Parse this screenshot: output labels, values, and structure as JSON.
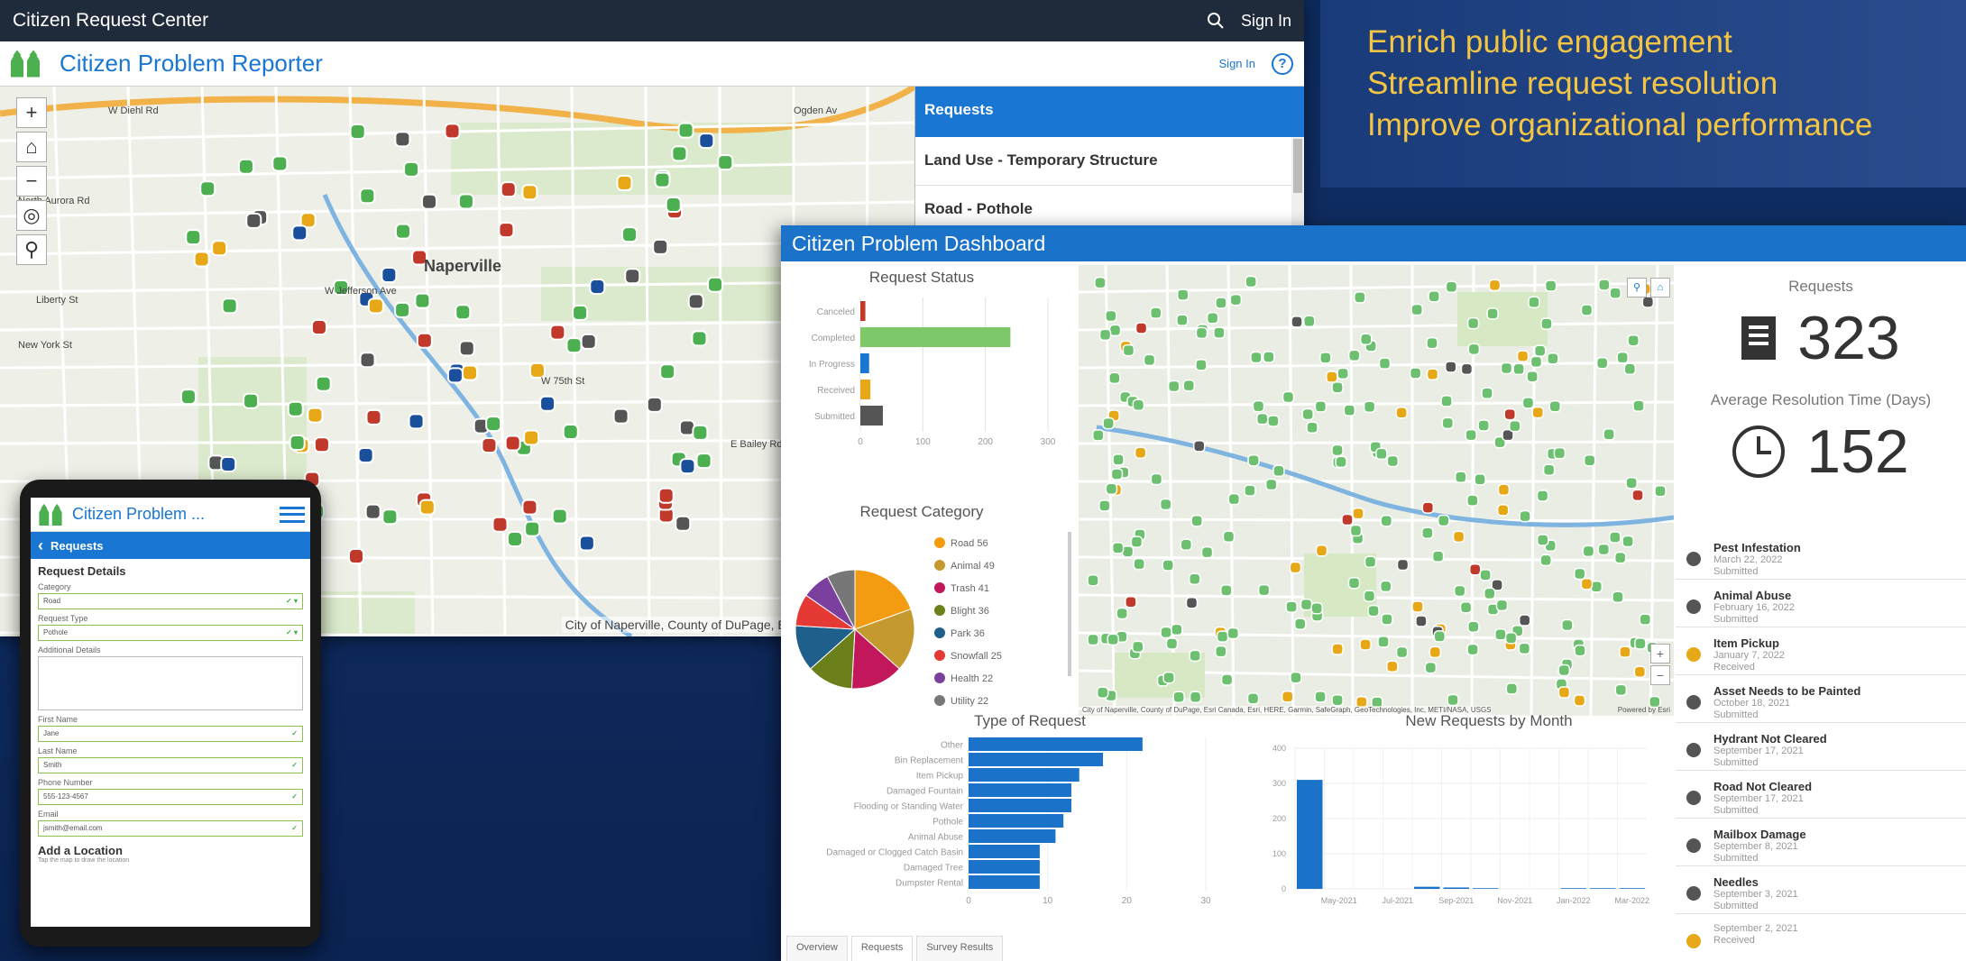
{
  "tagline": {
    "lines": [
      "Enrich public engagement",
      "Streamline request resolution",
      "Improve organizational performance"
    ]
  },
  "back_window": {
    "topbar_title": "Citizen Request Center",
    "topbar_signin": "Sign In",
    "app_title": "Citizen Problem Reporter",
    "app_signin": "Sign In",
    "help": "?",
    "map_attribution": "City of Naperville, County of DuPage, Esri, HERE, Garmin, S",
    "map_labels": [
      "W Diehl Rd",
      "Naperville",
      "W Jefferson Ave",
      "Liberty St",
      "New York St",
      "W 75th St",
      "North Aurora Rd",
      "E Bailey Rd",
      "Ogden Av"
    ],
    "requests_panel": {
      "header": "Requests",
      "items": [
        "Land Use - Temporary Structure",
        "Road - Pothole"
      ]
    }
  },
  "dashboard": {
    "title": "Citizen Problem Dashboard",
    "request_status": {
      "title": "Request Status",
      "chart_data": {
        "type": "bar",
        "orientation": "horizontal",
        "categories": [
          "Canceled",
          "Completed",
          "In Progress",
          "Received",
          "Submitted"
        ],
        "values": [
          8,
          240,
          14,
          16,
          36
        ],
        "colors": [
          "#c0392b",
          "#7dc96a",
          "#1976d2",
          "#e6a817",
          "#555555"
        ],
        "xticks": [
          0,
          100,
          200,
          300
        ],
        "xlim": [
          0,
          300
        ]
      }
    },
    "request_category": {
      "title": "Request Category",
      "chart_data": {
        "type": "pie",
        "categories": [
          "Road 56",
          "Animal 49",
          "Trash 41",
          "Blight 36",
          "Park 36",
          "Snowfall 25",
          "Health 22",
          "Utility 22"
        ],
        "values": [
          56,
          49,
          41,
          36,
          36,
          25,
          22,
          22
        ],
        "colors": [
          "#f39c12",
          "#c49a2e",
          "#c2185b",
          "#6b7f1a",
          "#1f5f8b",
          "#e53935",
          "#7b3f9e",
          "#777777"
        ]
      }
    },
    "kpi": {
      "requests_label": "Requests",
      "requests_value": "323",
      "resolution_label": "Average Resolution Time (Days)",
      "resolution_value": "152"
    },
    "request_list": [
      {
        "title": "Pest Infestation",
        "date": "March 22, 2022",
        "status": "Submitted",
        "color": "#555555"
      },
      {
        "title": "Animal Abuse",
        "date": "February 16, 2022",
        "status": "Submitted",
        "color": "#555555"
      },
      {
        "title": "Item Pickup",
        "date": "January 7, 2022",
        "status": "Received",
        "color": "#e6a817"
      },
      {
        "title": "Asset Needs to be Painted",
        "date": "October 18, 2021",
        "status": "Submitted",
        "color": "#555555"
      },
      {
        "title": "Hydrant Not Cleared",
        "date": "September 17, 2021",
        "status": "Submitted",
        "color": "#555555"
      },
      {
        "title": "Road Not Cleared",
        "date": "September 17, 2021",
        "status": "Submitted",
        "color": "#555555"
      },
      {
        "title": "Mailbox Damage",
        "date": "September 8, 2021",
        "status": "Submitted",
        "color": "#555555"
      },
      {
        "title": "Needles",
        "date": "September 3, 2021",
        "status": "Submitted",
        "color": "#555555"
      },
      {
        "title": "",
        "date": "September 2, 2021",
        "status": "Received",
        "color": "#e6a817"
      }
    ],
    "map_attribution": "City of Naperville, County of DuPage, Esri Canada, Esri, HERE, Garmin, SafeGraph, GeoTechnologies, Inc, METI/NASA, USGS",
    "map_powered": "Powered by Esri",
    "type_of_request": {
      "title": "Type of Request",
      "chart_data": {
        "type": "bar",
        "orientation": "horizontal",
        "categories": [
          "Other",
          "Bin Replacement",
          "Item Pickup",
          "Damaged Fountain",
          "Flooding or Standing Water",
          "Pothole",
          "Animal Abuse",
          "Damaged or Clogged Catch Basin",
          "Damaged Tree",
          "Dumpster Rental"
        ],
        "values": [
          22,
          17,
          14,
          13,
          13,
          12,
          11,
          9,
          9,
          9
        ],
        "xticks": [
          0,
          10,
          20,
          30
        ],
        "xlim": [
          0,
          30
        ],
        "color": "#1a73c8"
      }
    },
    "new_requests": {
      "title": "New Requests by Month",
      "chart_data": {
        "type": "bar",
        "categories": [
          "Apr-2021",
          "May-2021",
          "Jun-2021",
          "Jul-2021",
          "Aug-2021",
          "Sep-2021",
          "Oct-2021",
          "Nov-2021",
          "Dec-2021",
          "Jan-2022",
          "Feb-2022",
          "Mar-2022"
        ],
        "xtick_labels": [
          "May-2021",
          "Jul-2021",
          "Sep-2021",
          "Nov-2021",
          "Jan-2022",
          "Mar-2022"
        ],
        "values": [
          310,
          0,
          0,
          0,
          6,
          4,
          2,
          0,
          0,
          2,
          2,
          2
        ],
        "yticks": [
          0,
          100,
          200,
          300,
          400
        ],
        "ylim": [
          0,
          400
        ],
        "color": "#1a73c8"
      }
    },
    "tabs": [
      "Overview",
      "Requests",
      "Survey Results"
    ]
  },
  "phone": {
    "app_title": "Citizen Problem ...",
    "back_label": "Requests",
    "section_title": "Request Details",
    "fields": [
      {
        "label": "Category",
        "value": "Road",
        "kind": "select"
      },
      {
        "label": "Request Type",
        "value": "Pothole",
        "kind": "select"
      },
      {
        "label": "Additional Details",
        "value": "",
        "kind": "textarea"
      },
      {
        "label": "First Name",
        "value": "Jane",
        "kind": "text"
      },
      {
        "label": "Last Name",
        "value": "Smith",
        "kind": "text"
      },
      {
        "label": "Phone Number",
        "value": "555-123-4567",
        "kind": "text"
      },
      {
        "label": "Email",
        "value": "jsmith@email.com",
        "kind": "text"
      }
    ],
    "footer_title": "Add a Location",
    "footer_sub": "Tap the map to draw the location"
  }
}
